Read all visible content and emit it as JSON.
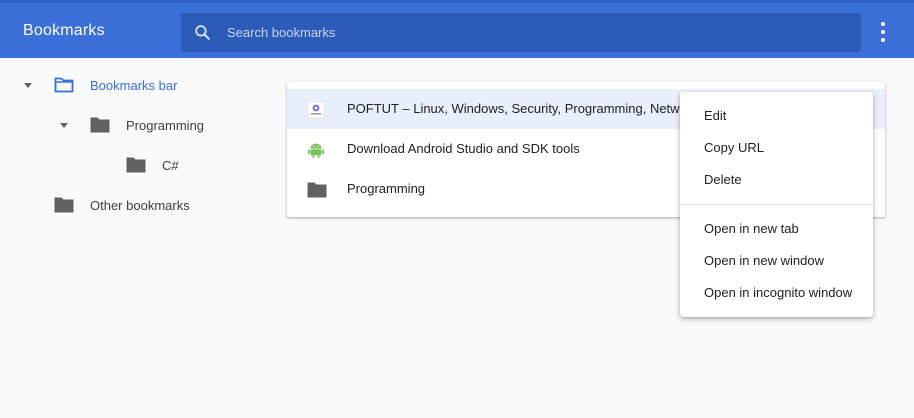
{
  "header": {
    "title": "Bookmarks",
    "search_placeholder": "Search bookmarks",
    "search_value": "",
    "icons": {
      "search": "search-icon",
      "menu": "more-vert-icon"
    }
  },
  "sidebar": {
    "items": [
      {
        "label": "Bookmarks bar",
        "selected": true,
        "expanded": true
      },
      {
        "label": "Programming",
        "expanded": true
      },
      {
        "label": "C#"
      },
      {
        "label": "Other bookmarks"
      }
    ]
  },
  "list": {
    "items": [
      {
        "title": "POFTUT – Linux, Windows, Security, Programming, Network",
        "icon": "poftut-favicon"
      },
      {
        "title": "Download Android Studio and SDK tools",
        "icon": "android-icon"
      },
      {
        "title": "Programming",
        "icon": "folder-icon"
      }
    ]
  },
  "context_menu": {
    "items": [
      {
        "label": "Edit"
      },
      {
        "label": "Copy URL"
      },
      {
        "label": "Delete"
      },
      {
        "label": "Open in new tab"
      },
      {
        "label": "Open in new window"
      },
      {
        "label": "Open in incognito window"
      }
    ]
  },
  "colors": {
    "header": "#3a6fd8",
    "search_box": "#2d5bb8",
    "selected_text": "#3a6fd8",
    "folder": "#616161",
    "android": "#78c257",
    "highlight_row": "#e8eefa"
  }
}
